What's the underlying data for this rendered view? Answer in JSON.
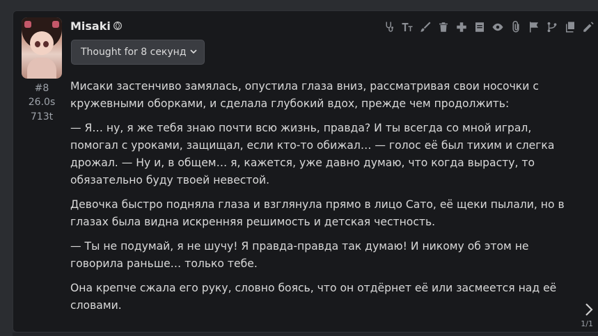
{
  "message": {
    "author": "Misaki",
    "index": "#8",
    "time": "26.0s",
    "tokens": "713t",
    "thought_label": "Thought for 8 секунд",
    "paragraphs": [
      "Мисаки застенчиво замялась, опустила глаза вниз, рассматривая свои носочки с кружевными оборками, и сделала глубокий вдох, прежде чем продолжить:",
      "— Я… ну, я же тебя знаю почти всю жизнь, правда? И ты всегда со мной играл, помогал с уроками, защищал, если кто-то обижал… — голос её был тихим и слегка дрожал. — Ну и, в общем… я, кажется, уже давно думаю, что когда вырасту, то обязательно буду твоей невестой.",
      "Девочка быстро подняла глаза и взглянула прямо в лицо Сато, её щеки пылали, но в глазах была видна искренняя решимость и детская честность.",
      "— Ты не подумай, я не шучу! Я правда-правда так думаю! И никому об этом не говорила раньше… только тебе.",
      "Она крепче сжала его руку, словно боясь, что он отдёрнет её или засмеется над её словами."
    ],
    "pager": "1/1"
  },
  "toolbar": {
    "icons": [
      "stethoscope-icon",
      "text-size-icon",
      "brush-icon",
      "trash-icon",
      "plus-icon",
      "note-icon",
      "eye-icon",
      "paperclip-icon",
      "flag-icon",
      "branch-icon",
      "copy-icon",
      "edit-icon"
    ]
  },
  "colors": {
    "background": "#2b2d31",
    "message_bg": "#18191c",
    "accent": "#8b8e94"
  }
}
